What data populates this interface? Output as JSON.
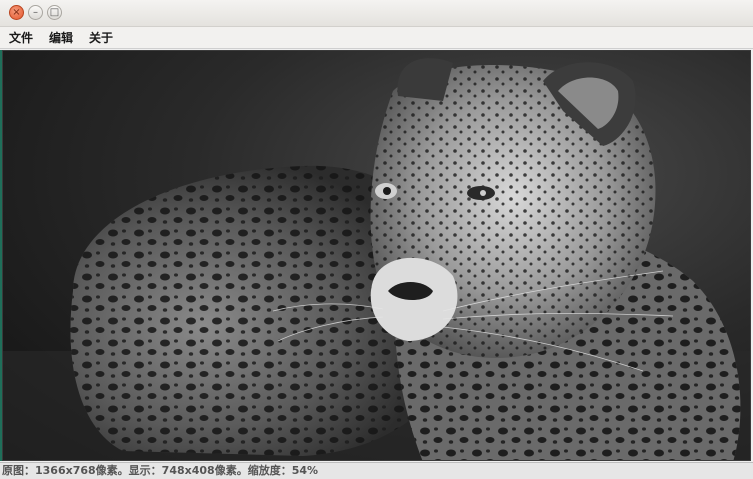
{
  "window": {
    "buttons": {
      "close_glyph": "×",
      "minimize_glyph": "–",
      "maximize_glyph": "□"
    }
  },
  "menubar": {
    "items": [
      {
        "label": "文件"
      },
      {
        "label": "编辑"
      },
      {
        "label": "关于"
      }
    ]
  },
  "viewer": {
    "image_subject": "leopard-photo"
  },
  "statusbar": {
    "text": "原图：1366x768像素。显示：748x408像素。缩放度：54%"
  },
  "colors": {
    "accent_close": "#e4572e",
    "left_edge": "#1f6f5a"
  }
}
